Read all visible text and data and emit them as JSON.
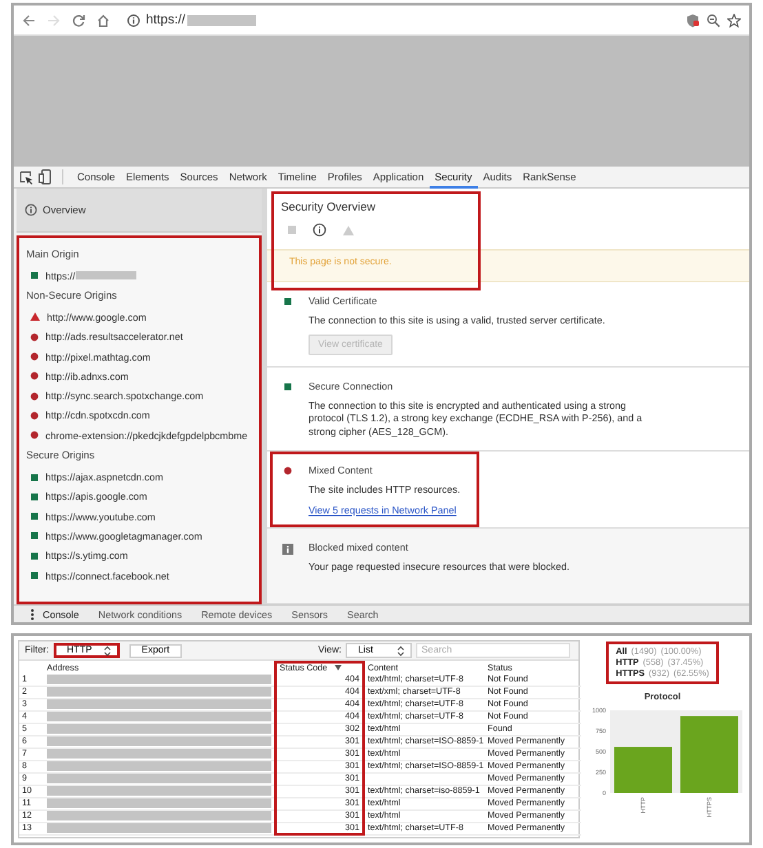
{
  "browser": {
    "url": "https://",
    "url_redacted": true
  },
  "devtools": {
    "tabs": [
      {
        "label": "Console",
        "selected": false
      },
      {
        "label": "Elements",
        "selected": false
      },
      {
        "label": "Sources",
        "selected": false
      },
      {
        "label": "Network",
        "selected": false
      },
      {
        "label": "Timeline",
        "selected": false
      },
      {
        "label": "Profiles",
        "selected": false
      },
      {
        "label": "Application",
        "selected": false
      },
      {
        "label": "Security",
        "selected": true
      },
      {
        "label": "Audits",
        "selected": false
      },
      {
        "label": "RankSense",
        "selected": false
      }
    ],
    "sidebar": {
      "overview": "Overview",
      "highlighted": true,
      "groups": [
        {
          "title": "Main Origin",
          "origins": [
            {
              "url": "https://",
              "kind": "secure",
              "redacted": true
            }
          ]
        },
        {
          "title": "Non-Secure Origins",
          "origins": [
            {
              "url": "http://www.google.com",
              "kind": "warning"
            },
            {
              "url": "http://ads.resultsaccelerator.net",
              "kind": "insecure"
            },
            {
              "url": "http://pixel.mathtag.com",
              "kind": "insecure"
            },
            {
              "url": "http://ib.adnxs.com",
              "kind": "insecure"
            },
            {
              "url": "http://sync.search.spotxchange.com",
              "kind": "insecure"
            },
            {
              "url": "http://cdn.spotxcdn.com",
              "kind": "insecure"
            },
            {
              "url": "chrome-extension://pkedcjkdefgpdelpbcmbme",
              "kind": "insecure"
            }
          ]
        },
        {
          "title": "Secure Origins",
          "origins": [
            {
              "url": "https://ajax.aspnetcdn.com",
              "kind": "secure"
            },
            {
              "url": "https://apis.google.com",
              "kind": "secure"
            },
            {
              "url": "https://www.youtube.com",
              "kind": "secure"
            },
            {
              "url": "https://www.googletagmanager.com",
              "kind": "secure"
            },
            {
              "url": "https://s.ytimg.com",
              "kind": "secure"
            },
            {
              "url": "https://connect.facebook.net",
              "kind": "secure"
            }
          ]
        }
      ]
    },
    "overview": {
      "title": "Security Overview",
      "banner": "This page is not secure.",
      "highlighted": true,
      "sections": [
        {
          "kind": "secure",
          "title": "Valid Certificate",
          "text": "The connection to this site is using a valid, trusted server certificate.",
          "button": {
            "label": "View certificate",
            "disabled": true
          }
        },
        {
          "kind": "secure",
          "title": "Secure Connection",
          "text": "The connection to this site is encrypted and authenticated using a strong protocol (TLS 1.2), a strong key exchange (ECDHE_RSA with P-256), and a strong cipher (AES_128_GCM)."
        },
        {
          "kind": "insecure",
          "title": "Mixed Content",
          "text": "The site includes HTTP resources.",
          "link": "View 5 requests in Network Panel",
          "highlighted": true
        },
        {
          "kind": "info",
          "title": "Blocked mixed content",
          "text": "Your page requested insecure resources that were blocked."
        }
      ]
    },
    "drawer_tabs": [
      {
        "label": "Console",
        "selected": true
      },
      {
        "label": "Network conditions",
        "selected": false
      },
      {
        "label": "Remote devices",
        "selected": false
      },
      {
        "label": "Sensors",
        "selected": false
      },
      {
        "label": "Search",
        "selected": false
      }
    ]
  },
  "network": {
    "filter_label": "Filter:",
    "filter_value": "HTTP",
    "filter_highlighted": true,
    "export": "Export",
    "view_label": "View:",
    "view_value": "List",
    "search_placeholder": "Search",
    "columns": [
      {
        "label": "Address"
      },
      {
        "label": "Status Code",
        "sorted": true,
        "highlighted": true
      },
      {
        "label": "Content"
      },
      {
        "label": "Status"
      }
    ],
    "rows": [
      {
        "index": "1",
        "status_code": "404",
        "content": "text/html; charset=UTF-8",
        "status": "Not Found"
      },
      {
        "index": "2",
        "status_code": "404",
        "content": "text/xml; charset=UTF-8",
        "status": "Not Found"
      },
      {
        "index": "3",
        "status_code": "404",
        "content": "text/html; charset=UTF-8",
        "status": "Not Found"
      },
      {
        "index": "4",
        "status_code": "404",
        "content": "text/html; charset=UTF-8",
        "status": "Not Found"
      },
      {
        "index": "5",
        "status_code": "302",
        "content": "text/html",
        "status": "Found"
      },
      {
        "index": "6",
        "status_code": "301",
        "content": "text/html; charset=ISO-8859-1",
        "status": "Moved Permanently"
      },
      {
        "index": "7",
        "status_code": "301",
        "content": "text/html",
        "status": "Moved Permanently"
      },
      {
        "index": "8",
        "status_code": "301",
        "content": "text/html; charset=ISO-8859-1",
        "status": "Moved Permanently"
      },
      {
        "index": "9",
        "status_code": "301",
        "status": "Moved Permanently"
      },
      {
        "index": "10",
        "status_code": "301",
        "content": "text/html; charset=iso-8859-1",
        "status": "Moved Permanently"
      },
      {
        "index": "11",
        "status_code": "301",
        "content": "text/html",
        "status": "Moved Permanently"
      },
      {
        "index": "12",
        "status_code": "301",
        "content": "text/html",
        "status": "Moved Permanently"
      },
      {
        "index": "13",
        "status_code": "301",
        "content": "text/html; charset=UTF-8",
        "status": "Moved Permanently"
      }
    ],
    "stats_highlighted": true,
    "stats": [
      {
        "label": "All",
        "count": "(1490)",
        "percent": "(100.00%)"
      },
      {
        "label": "HTTP",
        "count": "(558)",
        "percent": "(37.45%)"
      },
      {
        "label": "HTTPS",
        "count": "(932)",
        "percent": "(62.55%)"
      }
    ],
    "chart_data": {
      "type": "bar",
      "title": "Protocol",
      "categories": [
        "HTTP",
        "HTTPS"
      ],
      "series": [
        {
          "color": "#6aa51e",
          "values": [
            558,
            932
          ]
        }
      ],
      "ylim": [
        0,
        1000
      ],
      "yticks": [
        0,
        250,
        500,
        750,
        1000
      ]
    }
  }
}
